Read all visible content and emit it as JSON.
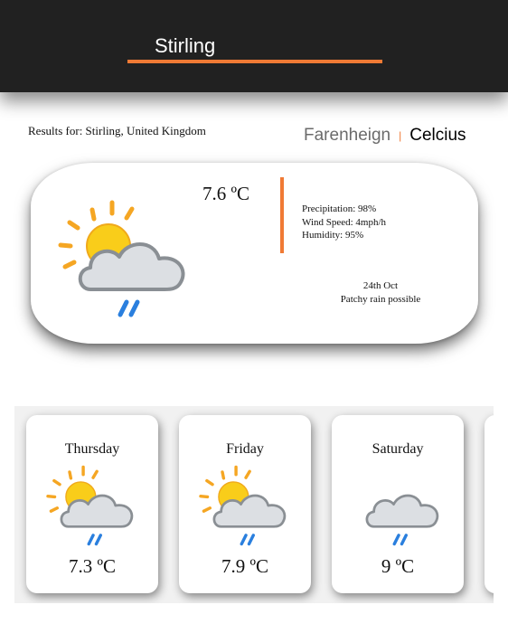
{
  "header": {
    "search_value": "Stirling",
    "accent_color": "#f07a35",
    "background_color": "#212121"
  },
  "results": {
    "text": "Results for: Stirling, United Kingdom"
  },
  "units": {
    "fahrenheit_label": "Farenheign",
    "separator": "|",
    "celsius_label": "Celcius",
    "selected": "Celcius"
  },
  "current": {
    "icon": "partly-cloudy-rain-icon",
    "temperature": "7.6 ºC",
    "precipitation": "Precipitation: 98%",
    "wind_speed": "Wind Speed: 4mph/h",
    "humidity": "Humidity: 95%",
    "date": "24th Oct",
    "condition": "Patchy rain possible"
  },
  "forecast": [
    {
      "day": "Thursday",
      "temperature": "7.3 ºC",
      "icon": "partly-cloudy-rain-icon"
    },
    {
      "day": "Friday",
      "temperature": "7.9 ºC",
      "icon": "partly-cloudy-rain-icon"
    },
    {
      "day": "Saturday",
      "temperature": "9 ºC",
      "icon": "cloud-rain-icon"
    }
  ]
}
